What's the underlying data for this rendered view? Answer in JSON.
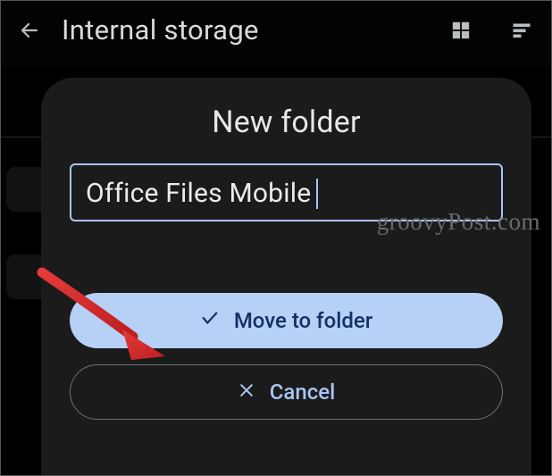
{
  "topbar": {
    "title": "Internal storage"
  },
  "dialog": {
    "title": "New folder",
    "input_value": "Office Files Mobile",
    "move_label": "Move to folder",
    "cancel_label": "Cancel"
  },
  "watermark": "groovyPost.com",
  "icons": {
    "back": "arrow-left-icon",
    "grid": "grid-view-icon",
    "sort": "sort-icon",
    "check": "check-icon",
    "close": "close-icon"
  }
}
